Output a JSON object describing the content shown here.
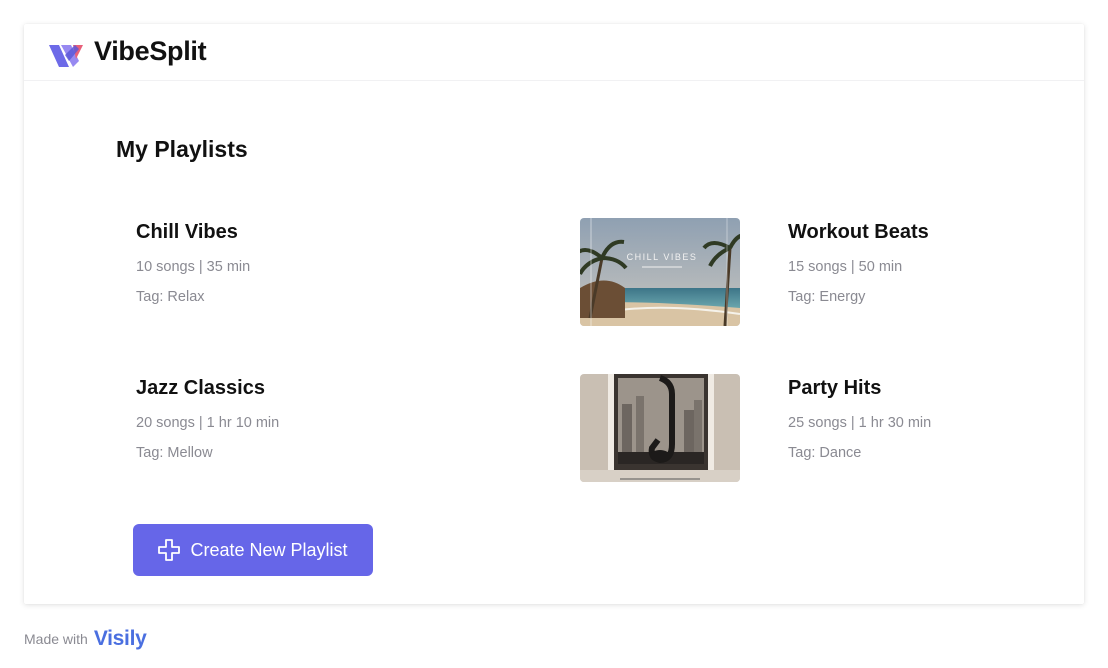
{
  "app": {
    "brand": "VibeSplit",
    "brand_color": "#6666e8"
  },
  "main": {
    "section_title": "My Playlists",
    "playlists": [
      {
        "title": "Chill Vibes",
        "meta": "10 songs | 35 min",
        "tag": "Tag: Relax"
      },
      {
        "title": "Workout Beats",
        "meta": "15 songs | 50 min",
        "tag": "Tag: Energy",
        "image_text": "CHILL VIBES",
        "image": "beach-palm-image"
      },
      {
        "title": "Jazz Classics",
        "meta": "20 songs | 1 hr 10 min",
        "tag": "Tag: Mellow"
      },
      {
        "title": "Party Hits",
        "meta": "25 songs | 1 hr 30 min",
        "tag": "Tag: Dance",
        "image": "saxophone-window-image"
      }
    ],
    "create_button": {
      "label": "Create New Playlist",
      "icon": "plus-icon"
    }
  },
  "footer": {
    "made_with": "Made with",
    "vendor": "Visily"
  }
}
